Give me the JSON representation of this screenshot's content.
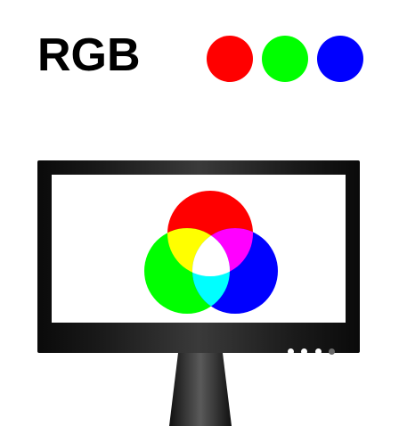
{
  "header": {
    "title": "RGB"
  },
  "colors": {
    "red": "#ff0000",
    "green": "#00ff00",
    "blue": "#0000ff",
    "yellow": "#ffff00",
    "magenta": "#ff00ff",
    "cyan": "#00ffff",
    "white": "#ffffff",
    "bezel": "#111111"
  },
  "icons": {
    "swatch_red": "red-dot-icon",
    "swatch_green": "green-dot-icon",
    "swatch_blue": "blue-dot-icon",
    "monitor": "monitor-icon"
  },
  "indicators": {
    "on_count": 3,
    "total": 4
  }
}
